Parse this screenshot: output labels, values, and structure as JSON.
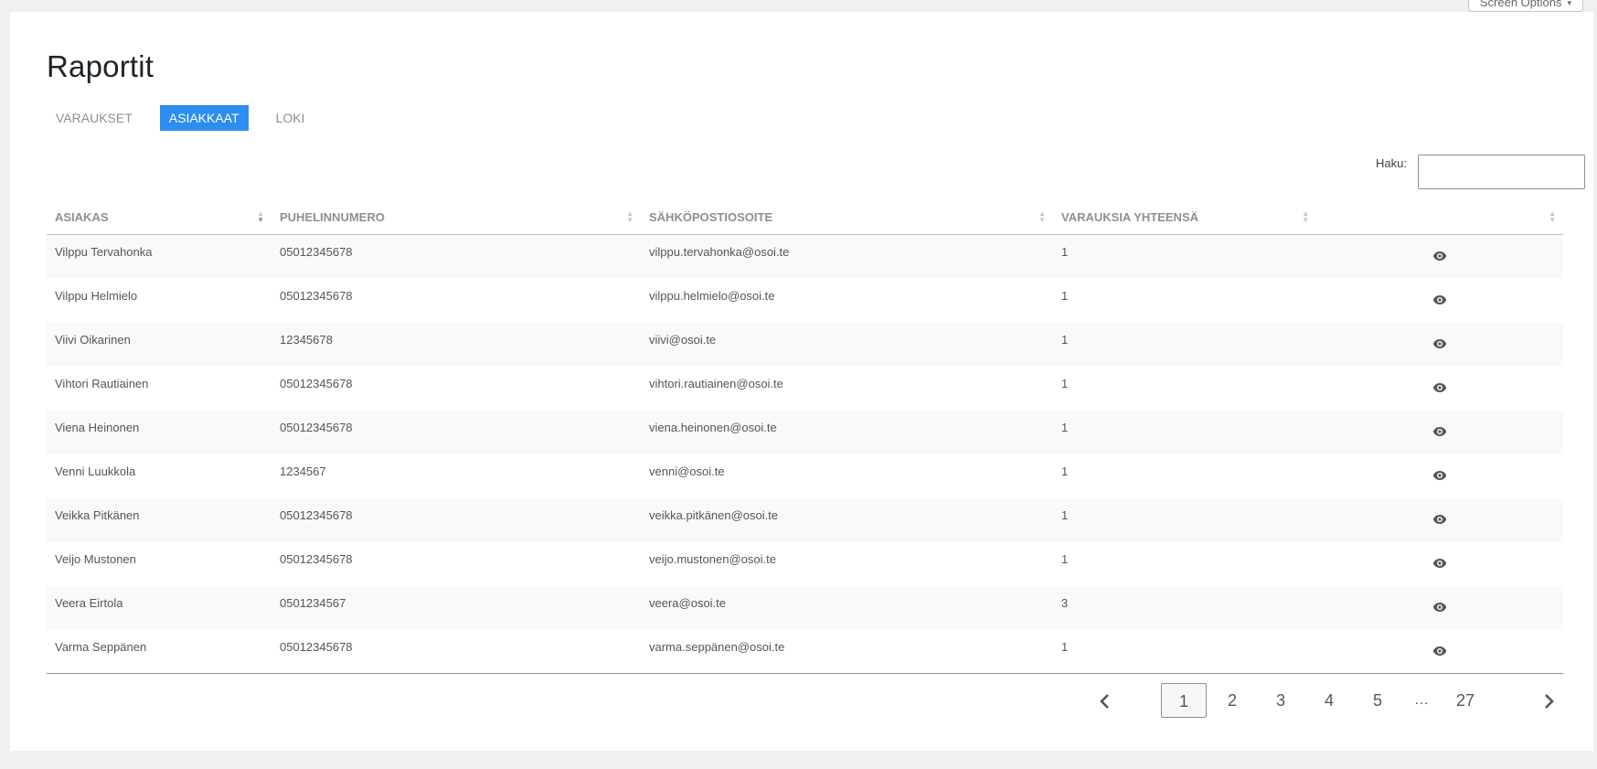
{
  "screen_options": {
    "label": "Screen Options",
    "arrow": "▾"
  },
  "page": {
    "title": "Raportit"
  },
  "tabs": [
    {
      "label": "VARAUKSET",
      "active": false
    },
    {
      "label": "ASIAKKAAT",
      "active": true
    },
    {
      "label": "LOKI",
      "active": false
    }
  ],
  "search": {
    "label": "Haku:",
    "value": "",
    "placeholder": ""
  },
  "table": {
    "columns": [
      "ASIAKAS",
      "PUHELINNUMERO",
      "SÄHKÖPOSTIOSOITE",
      "VARAUKSIA YHTEENSÄ",
      ""
    ],
    "rows": [
      {
        "name": "Vilppu Tervahonka",
        "phone": "05012345678",
        "email": "vilppu.tervahonka@osoi.te",
        "total": "1"
      },
      {
        "name": "Vilppu Helmielo",
        "phone": "05012345678",
        "email": "vilppu.helmielo@osoi.te",
        "total": "1"
      },
      {
        "name": "Viivi Oikarinen",
        "phone": "12345678",
        "email": "viivi@osoi.te",
        "total": "1"
      },
      {
        "name": "Vihtori Rautiainen",
        "phone": "05012345678",
        "email": "vihtori.rautiainen@osoi.te",
        "total": "1"
      },
      {
        "name": "Viena Heinonen",
        "phone": "05012345678",
        "email": "viena.heinonen@osoi.te",
        "total": "1"
      },
      {
        "name": "Venni Luukkola",
        "phone": "1234567",
        "email": "venni@osoi.te",
        "total": "1"
      },
      {
        "name": "Veikka Pitkänen",
        "phone": "05012345678",
        "email": "veikka.pitkänen@osoi.te",
        "total": "1"
      },
      {
        "name": "Veijo Mustonen",
        "phone": "05012345678",
        "email": "veijo.mustonen@osoi.te",
        "total": "1"
      },
      {
        "name": "Veera Eirtola",
        "phone": "0501234567",
        "email": "veera@osoi.te",
        "total": "3"
      },
      {
        "name": "Varma Seppänen",
        "phone": "05012345678",
        "email": "varma.seppänen@osoi.te",
        "total": "1"
      }
    ],
    "row_action_icon": "eye-icon"
  },
  "pagination": {
    "prev_icon": "chevron-left-icon",
    "next_icon": "chevron-right-icon",
    "pages": [
      "1",
      "2",
      "3",
      "4",
      "5"
    ],
    "ellipsis": "…",
    "last": "27",
    "current": "1"
  }
}
